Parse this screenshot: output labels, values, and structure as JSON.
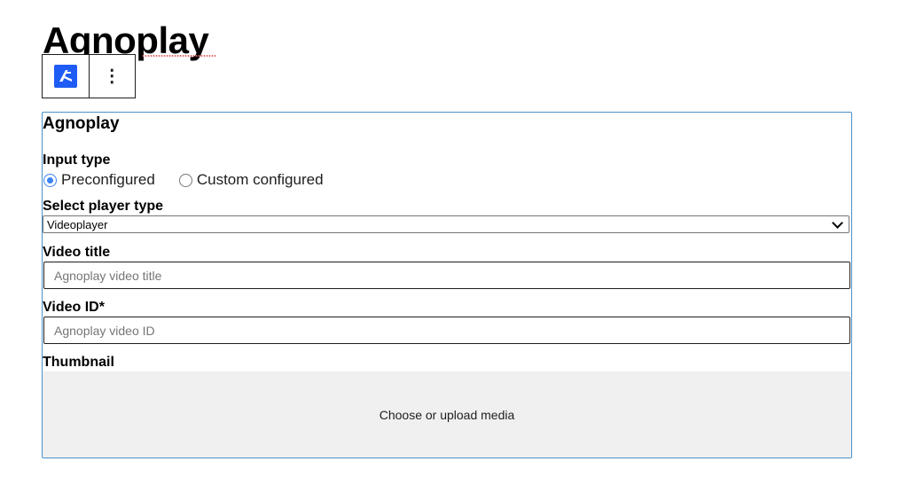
{
  "page": {
    "title": "Agnoplay"
  },
  "toolbar": {
    "block_icon": "agnoplay-logo-icon",
    "more_icon": "vertical-ellipsis-icon",
    "more_glyph": "⋮"
  },
  "block": {
    "title": "Agnoplay",
    "input_type": {
      "label": "Input type",
      "options": [
        {
          "label": "Preconfigured",
          "checked": true
        },
        {
          "label": "Custom configured",
          "checked": false
        }
      ]
    },
    "player_type": {
      "label": "Select player type",
      "value": "Videoplayer"
    },
    "video_title": {
      "label": "Video title",
      "value": "",
      "placeholder": "Agnoplay video title"
    },
    "video_id": {
      "label": "Video ID*",
      "value": "",
      "placeholder": "Agnoplay video ID"
    },
    "thumbnail": {
      "label": "Thumbnail",
      "button": "Choose or upload media"
    }
  },
  "colors": {
    "accent": "#1f5cf5",
    "block_border": "#4a90c8",
    "radio_checked": "#3b82f6",
    "media_bg": "#f0f0f0"
  }
}
